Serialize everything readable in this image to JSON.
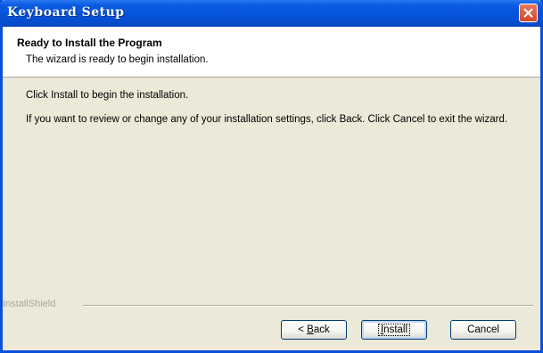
{
  "window": {
    "title": "Keyboard Setup"
  },
  "header": {
    "title": "Ready to Install the Program",
    "subtitle": "The wizard is ready to begin installation."
  },
  "body": {
    "line1": "Click Install to begin the installation.",
    "line2": "If you want to review or change any of your installation settings, click Back. Click Cancel to exit the wizard."
  },
  "footer": {
    "brand": "InstallShield"
  },
  "buttons": {
    "back_prefix": "< ",
    "back_mnemonic": "B",
    "back_rest": "ack",
    "install_mnemonic": "I",
    "install_rest": "nstall",
    "cancel": "Cancel"
  },
  "icons": {
    "close": "close-icon"
  },
  "colors": {
    "titlebar": "#0552d8",
    "close": "#d24a2a",
    "dialog_bg": "#ece9d8"
  }
}
